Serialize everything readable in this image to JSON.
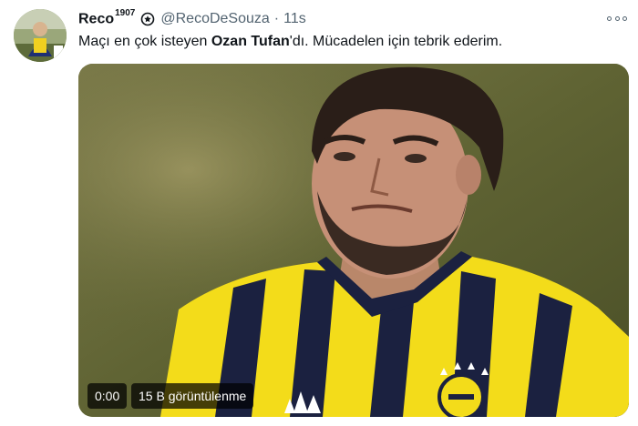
{
  "tweet": {
    "author_name": "Reco",
    "author_superscript": "1907",
    "handle": "@RecoDeSouza",
    "separator": "·",
    "timestamp": "11s",
    "text_before": "Maçı en çok isteyen ",
    "text_bold": "Ozan Tufan",
    "text_after": "'dı. Mücadelen için tebrik ederim.",
    "more_icon": "more-horizontal-icon",
    "verified_icon": "verified-badge-icon"
  },
  "video": {
    "elapsed": "0:00",
    "views": "15 B görüntülenme"
  },
  "colors": {
    "text_primary": "#0f1419",
    "text_secondary": "#536471",
    "jersey_yellow": "#f3dc1a",
    "jersey_navy": "#1b2140"
  }
}
